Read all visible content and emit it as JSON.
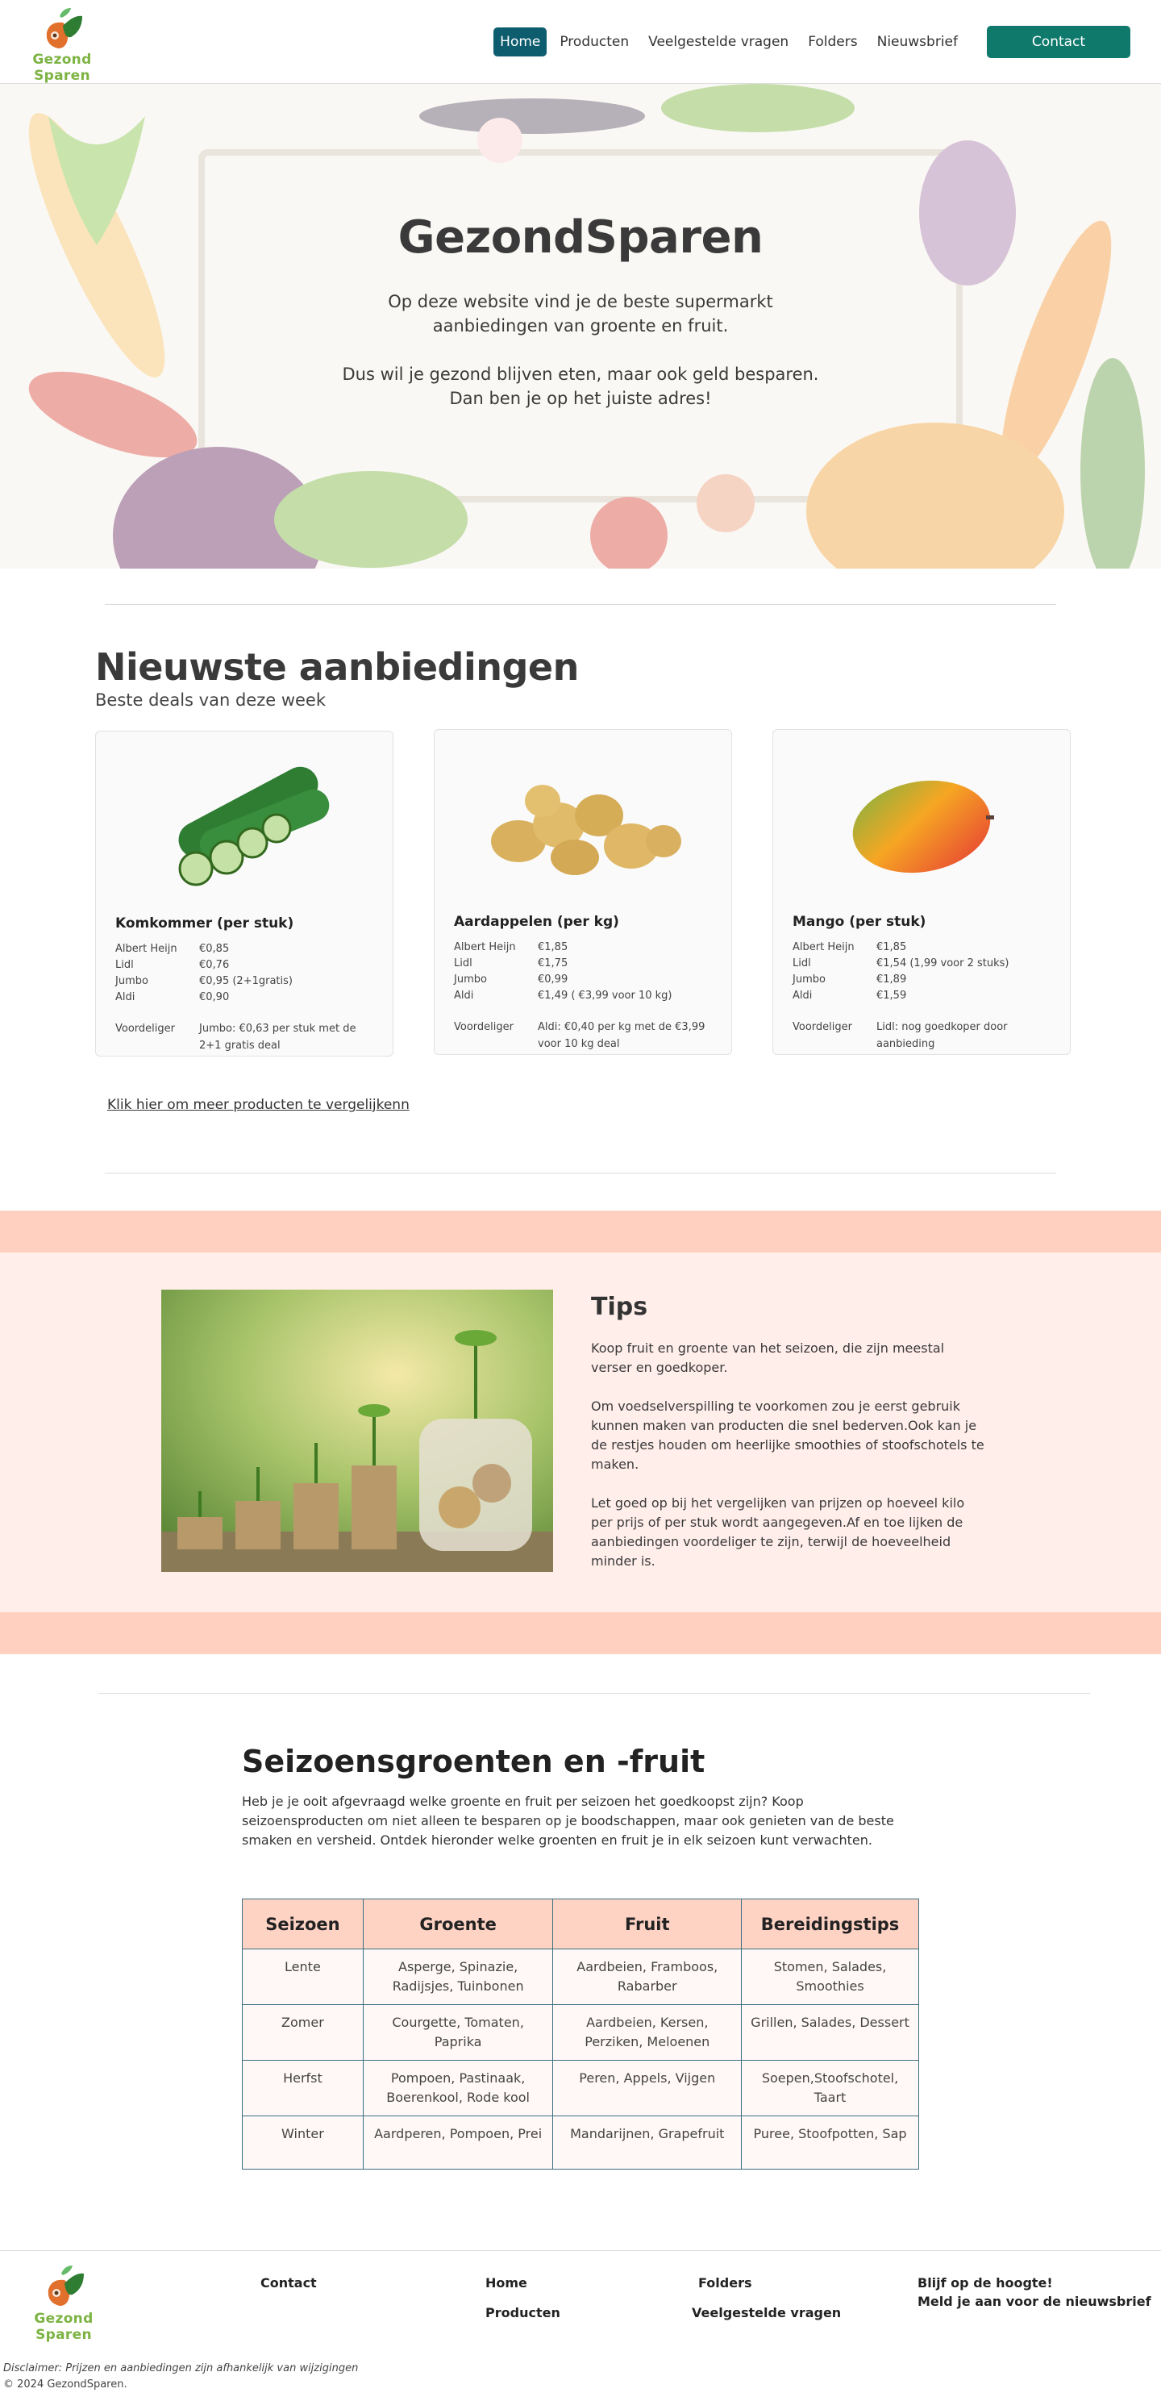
{
  "brand": {
    "logo_text": "Gezond Sparen"
  },
  "nav": {
    "items": [
      "Home",
      "Producten",
      "Veelgestelde vragen",
      "Folders",
      "Nieuwsbrief"
    ],
    "contact": "Contact"
  },
  "hero": {
    "title": "GezondSparen",
    "p1_line1": "Op deze website vind je de beste supermarkt",
    "p1_line2": "aanbiedingen van groente en fruit.",
    "p2_line1": "Dus wil je gezond blijven eten, maar ook geld besparen.",
    "p2_line2": "Dan ben je op het juiste adres!"
  },
  "offers": {
    "title": "Nieuwste aanbiedingen",
    "subtitle": "Beste deals van deze week",
    "more_link": "Klik hier om meer producten te vergelijkenn",
    "cards": [
      {
        "name": "Komkommer (per stuk)",
        "prices": [
          {
            "store": "Albert Heijn",
            "price": "€0,85"
          },
          {
            "store": "Lidl",
            "price": "€0,76"
          },
          {
            "store": "Jumbo",
            "price": "€0,95 (2+1gratis)"
          },
          {
            "store": "Aldi",
            "price": "€0,90"
          }
        ],
        "adv_label": "Voordeliger",
        "adv_text": "Jumbo:  €0,63 per stuk met de 2+1 gratis deal"
      },
      {
        "name": "Aardappelen (per kg)",
        "prices": [
          {
            "store": "Albert Heijn",
            "price": "€1,85"
          },
          {
            "store": "Lidl",
            "price": "€1,75"
          },
          {
            "store": "Jumbo",
            "price": "€0,99"
          },
          {
            "store": "Aldi",
            "price": "€1,49 ( €3,99 voor 10 kg)"
          }
        ],
        "adv_label": "Voordeliger",
        "adv_text": "Aldi: €0,40 per kg met de €3,99 voor 10 kg deal"
      },
      {
        "name": "Mango (per stuk)",
        "prices": [
          {
            "store": "Albert Heijn",
            "price": "€1,85"
          },
          {
            "store": "Lidl",
            "price": "€1,54 (1,99 voor 2 stuks)"
          },
          {
            "store": "Jumbo",
            "price": "€1,89"
          },
          {
            "store": "Aldi",
            "price": "€1,59"
          }
        ],
        "adv_label": "Voordeliger",
        "adv_text": "Lidl: nog goedkoper door aanbieding"
      }
    ]
  },
  "tips": {
    "title": "Tips",
    "paragraphs": [
      "Koop fruit en groente van het seizoen, die zijn meestal verser en goedkoper.",
      "Om voedselverspilling te voorkomen zou je eerst gebruik kunnen maken van producten die snel bederven.Ook kan je de restjes houden om heerlijke smoothies of stoofschotels te maken.",
      "Let goed op bij het vergelijken van prijzen op hoeveel kilo per prijs of per stuk wordt aangegeven.Af en toe lijken de aanbiedingen voordeliger te zijn, terwijl de hoeveelheid minder is."
    ]
  },
  "season": {
    "title": "Seizoensgroenten en -fruit",
    "intro": "Heb je je ooit afgevraagd welke groente en fruit per seizoen het goedkoopst zijn? Koop seizoensproducten om niet alleen te besparen op je boodschappen, maar ook genieten van de beste smaken en versheid. Ontdek hieronder welke groenten en fruit je in elk seizoen kunt verwachten.",
    "headers": [
      "Seizoen",
      "Groente",
      "Fruit",
      "Bereidingstips"
    ],
    "rows": [
      [
        "Lente",
        "Asperge, Spinazie, Radijsjes, Tuinbonen",
        "Aardbeien, Framboos, Rabarber",
        "Stomen, Salades, Smoothies"
      ],
      [
        "Zomer",
        "Courgette, Tomaten, Paprika",
        "Aardbeien, Kersen, Perziken, Meloenen",
        "Grillen, Salades, Dessert"
      ],
      [
        "Herfst",
        "Pompoen, Pastinaak, Boerenkool, Rode kool",
        "Peren, Appels, Vijgen",
        "Soepen,Stoofschotel, Taart"
      ],
      [
        "Winter",
        "Aardperen, Pompoen, Prei",
        "Mandarijnen, Grapefruit",
        "Puree, Stoofpotten, Sap"
      ]
    ]
  },
  "footer": {
    "logo_text": "Gezond Sparen",
    "contact": "Contact",
    "home": "Home",
    "producten": "Producten",
    "folders": "Folders",
    "faq": "Veelgestelde vragen",
    "news_title": "Blijf op de hoogte!",
    "news_link": "Meld je aan voor de nieuwsbrief",
    "disclaimer": "Disclaimer: Prijzen en aanbiedingen zijn afhankelijk van wijzigingen",
    "copyright": "© 2024 GezondSparen."
  }
}
